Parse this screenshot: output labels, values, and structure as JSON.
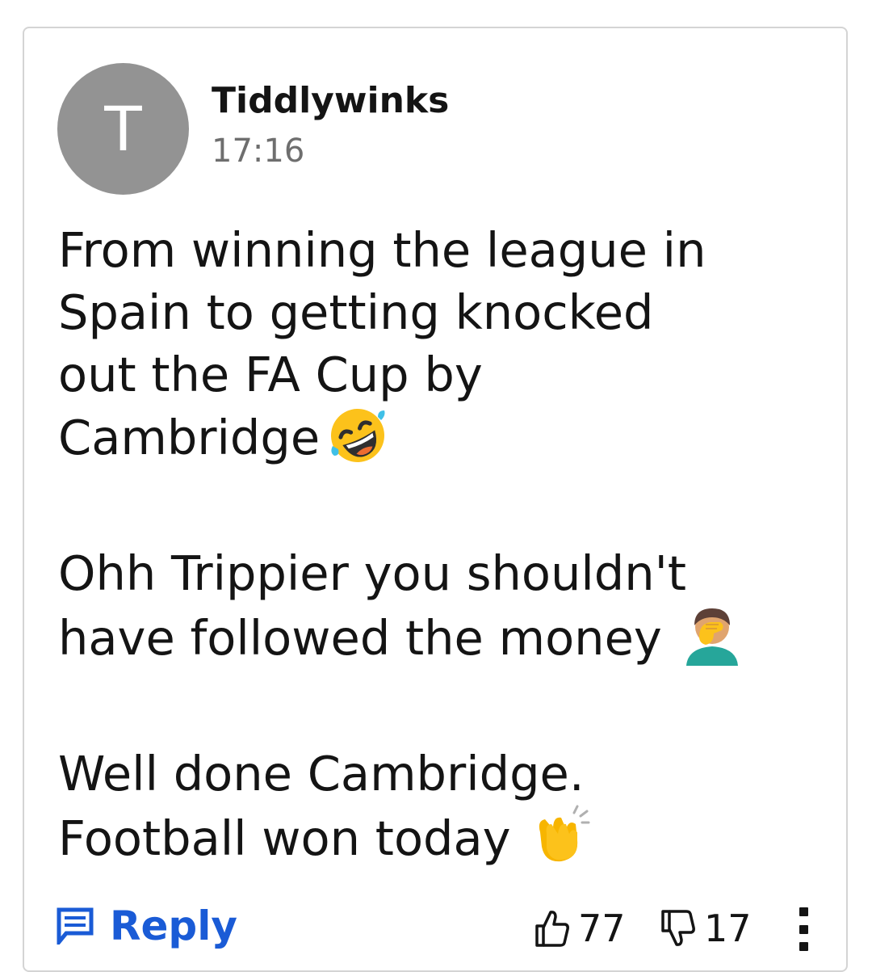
{
  "comment": {
    "avatar_letter": "T",
    "author": "Tiddlywinks",
    "time": "17:16",
    "paragraphs": [
      {
        "lines": [
          "From winning the league in",
          "Spain to getting knocked",
          "out the FA Cup by",
          "Cambridge"
        ],
        "emoji": "rolling-on-floor-laughing"
      },
      {
        "lines": [
          "Ohh Trippier you shouldn't",
          "have followed the money"
        ],
        "emoji": "man-facepalming"
      },
      {
        "lines": [
          "Well done Cambridge.",
          "Football won today"
        ],
        "emoji": "clapping-hands"
      }
    ]
  },
  "actions": {
    "reply_label": "Reply",
    "likes": "77",
    "dislikes": "17"
  },
  "icons": {
    "reply": "comment-icon",
    "like": "thumbs-up-icon",
    "dislike": "thumbs-down-icon",
    "more": "more-vertical-icon"
  },
  "colors": {
    "accent": "#1a5bd6",
    "avatar_bg": "#939393",
    "text": "#141414",
    "muted": "#6e6e6e",
    "border": "#d4d4d4"
  }
}
